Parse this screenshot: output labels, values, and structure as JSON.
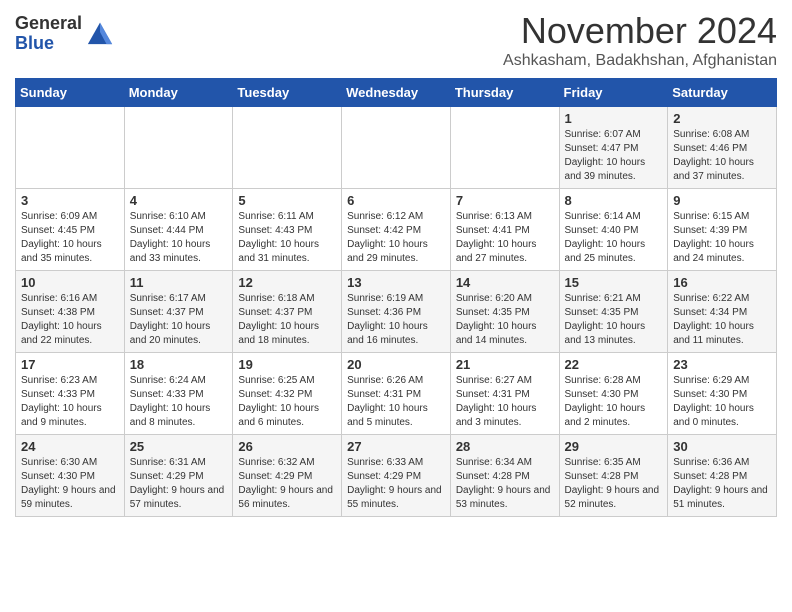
{
  "logo": {
    "general": "General",
    "blue": "Blue"
  },
  "header": {
    "month": "November 2024",
    "location": "Ashkasham, Badakhshan, Afghanistan"
  },
  "days_of_week": [
    "Sunday",
    "Monday",
    "Tuesday",
    "Wednesday",
    "Thursday",
    "Friday",
    "Saturday"
  ],
  "weeks": [
    [
      {
        "day": "",
        "info": ""
      },
      {
        "day": "",
        "info": ""
      },
      {
        "day": "",
        "info": ""
      },
      {
        "day": "",
        "info": ""
      },
      {
        "day": "",
        "info": ""
      },
      {
        "day": "1",
        "info": "Sunrise: 6:07 AM\nSunset: 4:47 PM\nDaylight: 10 hours and 39 minutes."
      },
      {
        "day": "2",
        "info": "Sunrise: 6:08 AM\nSunset: 4:46 PM\nDaylight: 10 hours and 37 minutes."
      }
    ],
    [
      {
        "day": "3",
        "info": "Sunrise: 6:09 AM\nSunset: 4:45 PM\nDaylight: 10 hours and 35 minutes."
      },
      {
        "day": "4",
        "info": "Sunrise: 6:10 AM\nSunset: 4:44 PM\nDaylight: 10 hours and 33 minutes."
      },
      {
        "day": "5",
        "info": "Sunrise: 6:11 AM\nSunset: 4:43 PM\nDaylight: 10 hours and 31 minutes."
      },
      {
        "day": "6",
        "info": "Sunrise: 6:12 AM\nSunset: 4:42 PM\nDaylight: 10 hours and 29 minutes."
      },
      {
        "day": "7",
        "info": "Sunrise: 6:13 AM\nSunset: 4:41 PM\nDaylight: 10 hours and 27 minutes."
      },
      {
        "day": "8",
        "info": "Sunrise: 6:14 AM\nSunset: 4:40 PM\nDaylight: 10 hours and 25 minutes."
      },
      {
        "day": "9",
        "info": "Sunrise: 6:15 AM\nSunset: 4:39 PM\nDaylight: 10 hours and 24 minutes."
      }
    ],
    [
      {
        "day": "10",
        "info": "Sunrise: 6:16 AM\nSunset: 4:38 PM\nDaylight: 10 hours and 22 minutes."
      },
      {
        "day": "11",
        "info": "Sunrise: 6:17 AM\nSunset: 4:37 PM\nDaylight: 10 hours and 20 minutes."
      },
      {
        "day": "12",
        "info": "Sunrise: 6:18 AM\nSunset: 4:37 PM\nDaylight: 10 hours and 18 minutes."
      },
      {
        "day": "13",
        "info": "Sunrise: 6:19 AM\nSunset: 4:36 PM\nDaylight: 10 hours and 16 minutes."
      },
      {
        "day": "14",
        "info": "Sunrise: 6:20 AM\nSunset: 4:35 PM\nDaylight: 10 hours and 14 minutes."
      },
      {
        "day": "15",
        "info": "Sunrise: 6:21 AM\nSunset: 4:35 PM\nDaylight: 10 hours and 13 minutes."
      },
      {
        "day": "16",
        "info": "Sunrise: 6:22 AM\nSunset: 4:34 PM\nDaylight: 10 hours and 11 minutes."
      }
    ],
    [
      {
        "day": "17",
        "info": "Sunrise: 6:23 AM\nSunset: 4:33 PM\nDaylight: 10 hours and 9 minutes."
      },
      {
        "day": "18",
        "info": "Sunrise: 6:24 AM\nSunset: 4:33 PM\nDaylight: 10 hours and 8 minutes."
      },
      {
        "day": "19",
        "info": "Sunrise: 6:25 AM\nSunset: 4:32 PM\nDaylight: 10 hours and 6 minutes."
      },
      {
        "day": "20",
        "info": "Sunrise: 6:26 AM\nSunset: 4:31 PM\nDaylight: 10 hours and 5 minutes."
      },
      {
        "day": "21",
        "info": "Sunrise: 6:27 AM\nSunset: 4:31 PM\nDaylight: 10 hours and 3 minutes."
      },
      {
        "day": "22",
        "info": "Sunrise: 6:28 AM\nSunset: 4:30 PM\nDaylight: 10 hours and 2 minutes."
      },
      {
        "day": "23",
        "info": "Sunrise: 6:29 AM\nSunset: 4:30 PM\nDaylight: 10 hours and 0 minutes."
      }
    ],
    [
      {
        "day": "24",
        "info": "Sunrise: 6:30 AM\nSunset: 4:30 PM\nDaylight: 9 hours and 59 minutes."
      },
      {
        "day": "25",
        "info": "Sunrise: 6:31 AM\nSunset: 4:29 PM\nDaylight: 9 hours and 57 minutes."
      },
      {
        "day": "26",
        "info": "Sunrise: 6:32 AM\nSunset: 4:29 PM\nDaylight: 9 hours and 56 minutes."
      },
      {
        "day": "27",
        "info": "Sunrise: 6:33 AM\nSunset: 4:29 PM\nDaylight: 9 hours and 55 minutes."
      },
      {
        "day": "28",
        "info": "Sunrise: 6:34 AM\nSunset: 4:28 PM\nDaylight: 9 hours and 53 minutes."
      },
      {
        "day": "29",
        "info": "Sunrise: 6:35 AM\nSunset: 4:28 PM\nDaylight: 9 hours and 52 minutes."
      },
      {
        "day": "30",
        "info": "Sunrise: 6:36 AM\nSunset: 4:28 PM\nDaylight: 9 hours and 51 minutes."
      }
    ]
  ]
}
